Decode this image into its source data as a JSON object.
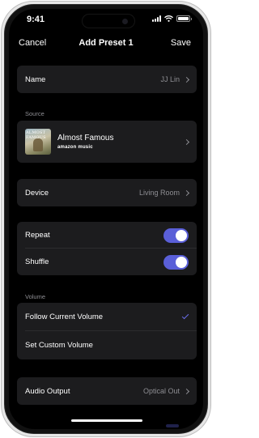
{
  "status_bar": {
    "time": "9:41"
  },
  "nav": {
    "cancel_label": "Cancel",
    "title": "Add Preset 1",
    "save_label": "Save"
  },
  "name_row": {
    "label": "Name",
    "value": "JJ Lin"
  },
  "source": {
    "section_label": "Source",
    "album_title": "Almost Famous",
    "service": "amazon music",
    "album_art_text": "ALMOST FAMOUS"
  },
  "device_row": {
    "label": "Device",
    "value": "Living Room"
  },
  "playback": {
    "repeat_label": "Repeat",
    "repeat_on": true,
    "shuffle_label": "Shuffle",
    "shuffle_on": true
  },
  "volume": {
    "section_label": "Volume",
    "options": [
      {
        "label": "Follow Current Volume",
        "selected": true
      },
      {
        "label": "Set Custom Volume",
        "selected": false
      }
    ]
  },
  "audio_output_row": {
    "label": "Audio Output",
    "value": "Optical Out"
  },
  "colors": {
    "accent": "#5a5fd8",
    "card": "#1c1c1e",
    "background": "#000000",
    "secondary_text": "#8e8e93"
  }
}
